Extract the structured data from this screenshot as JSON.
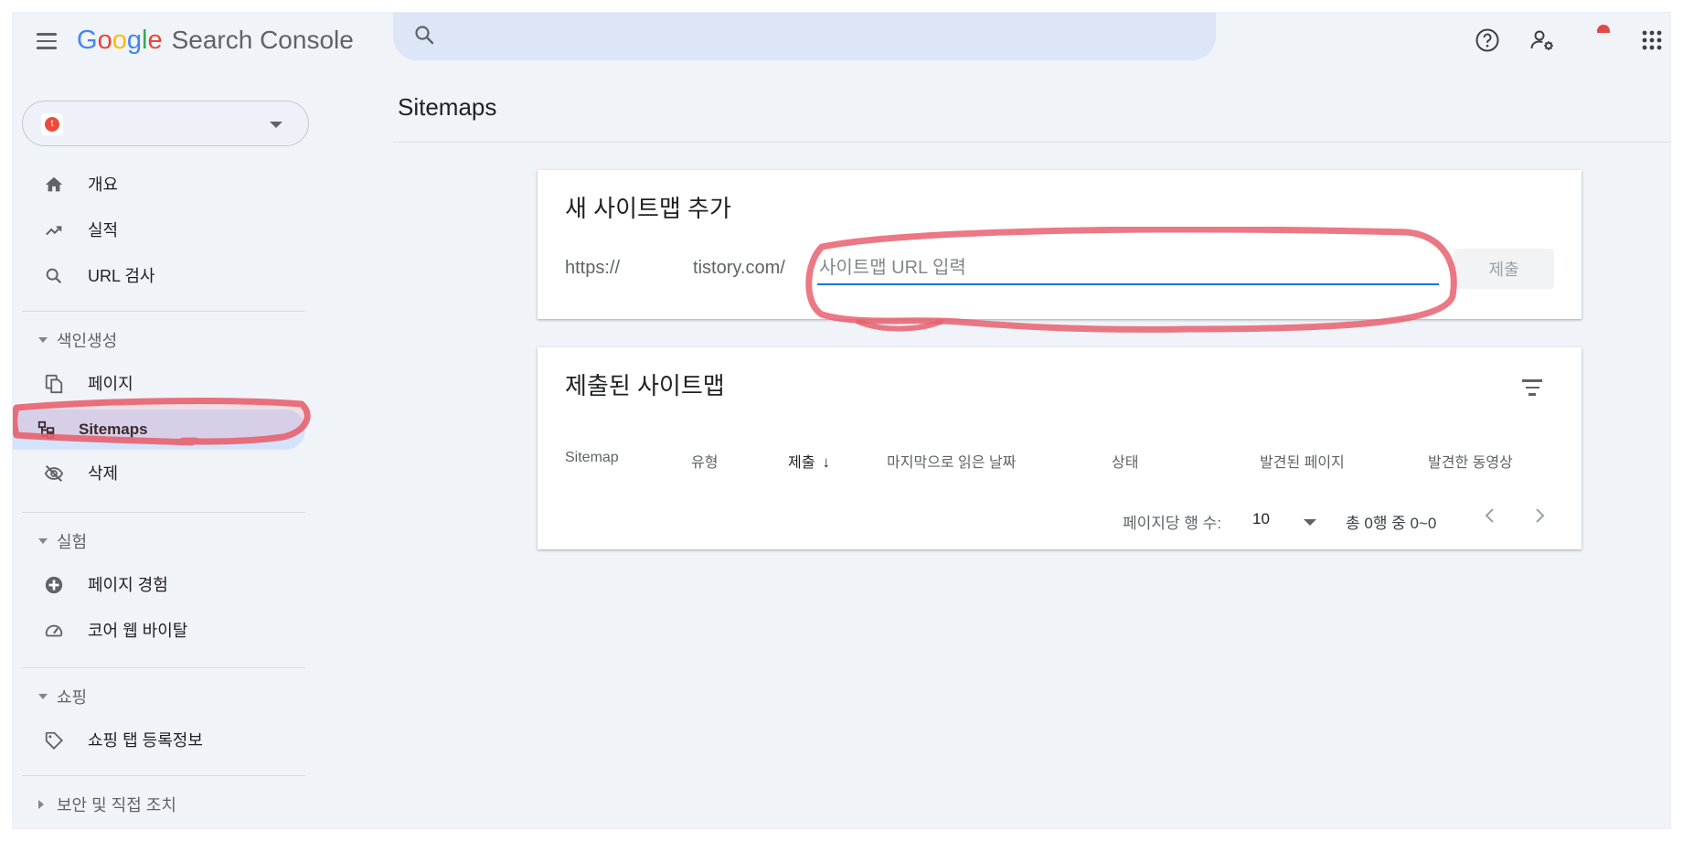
{
  "app": {
    "logo_google": [
      "G",
      "o",
      "o",
      "g",
      "l",
      "e"
    ],
    "logo_colors": [
      "#4285F4",
      "#EA4335",
      "#FBBC05",
      "#4285F4",
      "#34A853",
      "#EA4335"
    ],
    "product_name": "Search Console"
  },
  "header": {
    "search_value": "",
    "icons": [
      "menu-icon",
      "search-icon",
      "help-icon",
      "manage-users-icon",
      "apps-grid-icon"
    ]
  },
  "sidebar": {
    "property_name": "",
    "items": {
      "overview": "개요",
      "performance": "실적",
      "url_inspection": "URL 검사",
      "pages": "페이지",
      "sitemaps": "Sitemaps",
      "removals": "삭제",
      "page_experience": "페이지 경험",
      "core_web_vitals": "코어 웹 바이탈",
      "shopping_listings": "쇼핑 탭 등록정보"
    },
    "sections": {
      "indexing": "색인생성",
      "experience": "실험",
      "shopping": "쇼핑",
      "security": "보안 및 직접 조치"
    }
  },
  "main": {
    "page_title": "Sitemaps",
    "add_card": {
      "title": "새 사이트맵 추가",
      "url_prefix_start": "https://",
      "url_prefix_end": "tistory.com/",
      "input_value": "",
      "input_placeholder": "사이트맵 URL 입력",
      "submit_label": "제출"
    },
    "submitted_card": {
      "title": "제출된 사이트맵",
      "columns": {
        "sitemap": "Sitemap",
        "type": "유형",
        "submitted": "제출",
        "last_read": "마지막으로 읽은 날짜",
        "status": "상태",
        "discovered_pages": "발견된 페이지",
        "discovered_videos": "발견한 동영상"
      },
      "pagination": {
        "rows_per_page_label": "페이지당 행 수:",
        "rows_per_page": "10",
        "range": "총 0행 중 0~0"
      }
    }
  },
  "colors": {
    "accent": "#1a73e8",
    "active_nav_bg": "#d3e3fd",
    "annotation": "#e8606e",
    "page_bg": "#f0f4f9"
  }
}
